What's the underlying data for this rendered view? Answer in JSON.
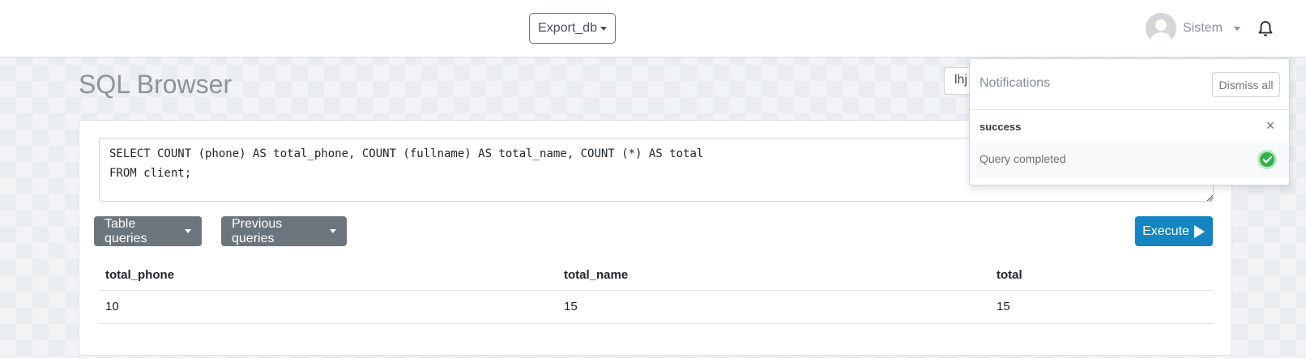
{
  "topbar": {
    "database": "Export_db",
    "user_name": "Sistem",
    "icons": {
      "avatar": "user-avatar",
      "bell": "bell-icon"
    }
  },
  "page": {
    "title": "SQL Browser",
    "partial_input_value": "lhj"
  },
  "editor": {
    "query": "SELECT COUNT (phone) AS total_phone, COUNT (fullname) AS total_name, COUNT (*) AS total\nFROM client;"
  },
  "toolbar": {
    "table_queries": "Table queries",
    "previous_queries": "Previous queries",
    "execute": "Execute"
  },
  "results": {
    "columns": [
      "total_phone",
      "total_name",
      "total"
    ],
    "rows": [
      [
        "10",
        "15",
        "15"
      ]
    ]
  },
  "notifications": {
    "title": "Notifications",
    "dismiss_all": "Dismiss all",
    "items": [
      {
        "title": "success",
        "message": "Query completed",
        "close": "×"
      }
    ]
  },
  "colors": {
    "execute_button": "#1485c0",
    "secondary_button": "#6c757d",
    "success_check": "#2eb34a"
  }
}
